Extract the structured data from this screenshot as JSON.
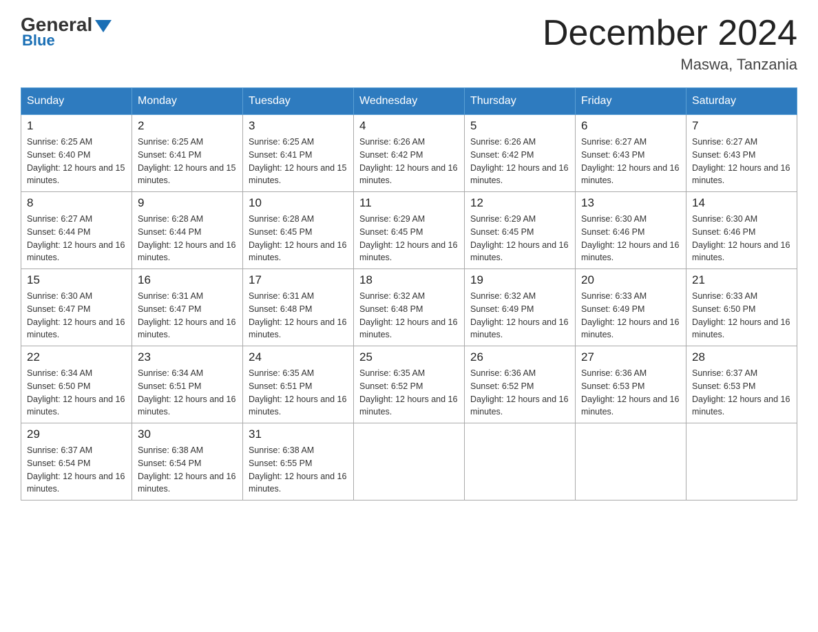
{
  "logo": {
    "general": "General",
    "blue": "Blue"
  },
  "title": "December 2024",
  "location": "Maswa, Tanzania",
  "days_of_week": [
    "Sunday",
    "Monday",
    "Tuesday",
    "Wednesday",
    "Thursday",
    "Friday",
    "Saturday"
  ],
  "weeks": [
    [
      {
        "day": "1",
        "sunrise": "6:25 AM",
        "sunset": "6:40 PM",
        "daylight": "12 hours and 15 minutes."
      },
      {
        "day": "2",
        "sunrise": "6:25 AM",
        "sunset": "6:41 PM",
        "daylight": "12 hours and 15 minutes."
      },
      {
        "day": "3",
        "sunrise": "6:25 AM",
        "sunset": "6:41 PM",
        "daylight": "12 hours and 15 minutes."
      },
      {
        "day": "4",
        "sunrise": "6:26 AM",
        "sunset": "6:42 PM",
        "daylight": "12 hours and 16 minutes."
      },
      {
        "day": "5",
        "sunrise": "6:26 AM",
        "sunset": "6:42 PM",
        "daylight": "12 hours and 16 minutes."
      },
      {
        "day": "6",
        "sunrise": "6:27 AM",
        "sunset": "6:43 PM",
        "daylight": "12 hours and 16 minutes."
      },
      {
        "day": "7",
        "sunrise": "6:27 AM",
        "sunset": "6:43 PM",
        "daylight": "12 hours and 16 minutes."
      }
    ],
    [
      {
        "day": "8",
        "sunrise": "6:27 AM",
        "sunset": "6:44 PM",
        "daylight": "12 hours and 16 minutes."
      },
      {
        "day": "9",
        "sunrise": "6:28 AM",
        "sunset": "6:44 PM",
        "daylight": "12 hours and 16 minutes."
      },
      {
        "day": "10",
        "sunrise": "6:28 AM",
        "sunset": "6:45 PM",
        "daylight": "12 hours and 16 minutes."
      },
      {
        "day": "11",
        "sunrise": "6:29 AM",
        "sunset": "6:45 PM",
        "daylight": "12 hours and 16 minutes."
      },
      {
        "day": "12",
        "sunrise": "6:29 AM",
        "sunset": "6:45 PM",
        "daylight": "12 hours and 16 minutes."
      },
      {
        "day": "13",
        "sunrise": "6:30 AM",
        "sunset": "6:46 PM",
        "daylight": "12 hours and 16 minutes."
      },
      {
        "day": "14",
        "sunrise": "6:30 AM",
        "sunset": "6:46 PM",
        "daylight": "12 hours and 16 minutes."
      }
    ],
    [
      {
        "day": "15",
        "sunrise": "6:30 AM",
        "sunset": "6:47 PM",
        "daylight": "12 hours and 16 minutes."
      },
      {
        "day": "16",
        "sunrise": "6:31 AM",
        "sunset": "6:47 PM",
        "daylight": "12 hours and 16 minutes."
      },
      {
        "day": "17",
        "sunrise": "6:31 AM",
        "sunset": "6:48 PM",
        "daylight": "12 hours and 16 minutes."
      },
      {
        "day": "18",
        "sunrise": "6:32 AM",
        "sunset": "6:48 PM",
        "daylight": "12 hours and 16 minutes."
      },
      {
        "day": "19",
        "sunrise": "6:32 AM",
        "sunset": "6:49 PM",
        "daylight": "12 hours and 16 minutes."
      },
      {
        "day": "20",
        "sunrise": "6:33 AM",
        "sunset": "6:49 PM",
        "daylight": "12 hours and 16 minutes."
      },
      {
        "day": "21",
        "sunrise": "6:33 AM",
        "sunset": "6:50 PM",
        "daylight": "12 hours and 16 minutes."
      }
    ],
    [
      {
        "day": "22",
        "sunrise": "6:34 AM",
        "sunset": "6:50 PM",
        "daylight": "12 hours and 16 minutes."
      },
      {
        "day": "23",
        "sunrise": "6:34 AM",
        "sunset": "6:51 PM",
        "daylight": "12 hours and 16 minutes."
      },
      {
        "day": "24",
        "sunrise": "6:35 AM",
        "sunset": "6:51 PM",
        "daylight": "12 hours and 16 minutes."
      },
      {
        "day": "25",
        "sunrise": "6:35 AM",
        "sunset": "6:52 PM",
        "daylight": "12 hours and 16 minutes."
      },
      {
        "day": "26",
        "sunrise": "6:36 AM",
        "sunset": "6:52 PM",
        "daylight": "12 hours and 16 minutes."
      },
      {
        "day": "27",
        "sunrise": "6:36 AM",
        "sunset": "6:53 PM",
        "daylight": "12 hours and 16 minutes."
      },
      {
        "day": "28",
        "sunrise": "6:37 AM",
        "sunset": "6:53 PM",
        "daylight": "12 hours and 16 minutes."
      }
    ],
    [
      {
        "day": "29",
        "sunrise": "6:37 AM",
        "sunset": "6:54 PM",
        "daylight": "12 hours and 16 minutes."
      },
      {
        "day": "30",
        "sunrise": "6:38 AM",
        "sunset": "6:54 PM",
        "daylight": "12 hours and 16 minutes."
      },
      {
        "day": "31",
        "sunrise": "6:38 AM",
        "sunset": "6:55 PM",
        "daylight": "12 hours and 16 minutes."
      },
      null,
      null,
      null,
      null
    ]
  ]
}
